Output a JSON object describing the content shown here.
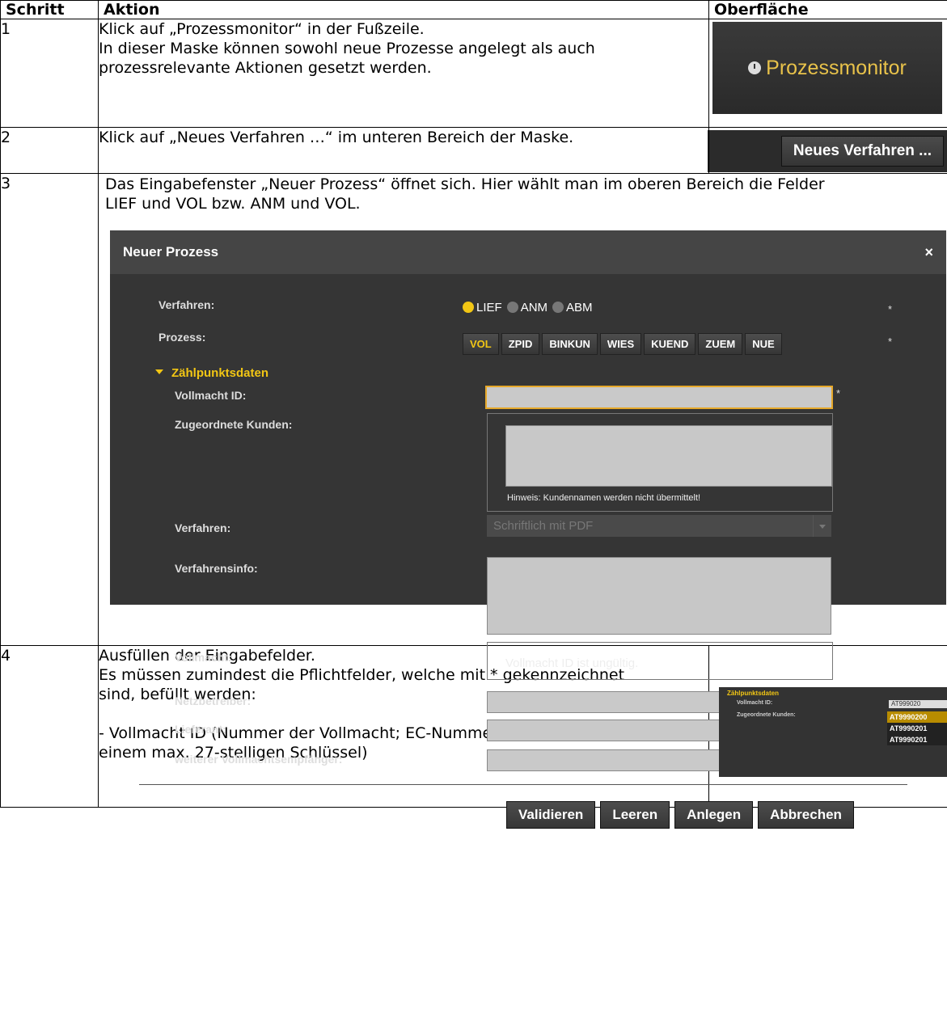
{
  "header": {
    "col1": "Schritt",
    "col2": "Aktion",
    "col3": "Oberfläche"
  },
  "rows": [
    {
      "nr": "1",
      "lines": [
        "Klick auf „Prozessmonitor“ in der Fußzeile.",
        "In dieser Maske können sowohl neue Prozesse angelegt als auch",
        "prozessrelevante Aktionen gesetzt werden."
      ],
      "ui_label": "Prozessmonitor"
    },
    {
      "nr": "2",
      "lines": [
        "Klick auf „Neues Verfahren …“ im unteren Bereich der Maske."
      ],
      "ui_label": "Neues Verfahren ..."
    },
    {
      "nr": "3",
      "lines": [
        "Das Eingabefenster „Neuer Prozess“ öffnet sich. Hier wählt man im oberen Bereich die Felder",
        "LIEF und VOL bzw. ANM und VOL."
      ]
    },
    {
      "nr": "4",
      "lines": [
        "Ausfüllen der Eingabefelder.",
        "Es müssen zumindest die Pflichtfelder, welche mit * gekennzeichnet",
        "sind, befüllt werden:",
        "",
        "- Vollmacht ID (Nummer der Vollmacht; EC-Nummer gefolgt von",
        "einem max. 27-stelligen Schlüssel)"
      ]
    }
  ],
  "dialog": {
    "title": "Neuer Prozess",
    "close": "×",
    "verfahren_label": "Verfahren:",
    "radios": [
      "LIEF",
      "ANM",
      "ABM"
    ],
    "radio_selected": "LIEF",
    "prozess_label": "Prozess:",
    "prozess_buttons": [
      "VOL",
      "ZPID",
      "BINKUN",
      "WIES",
      "KUEND",
      "ZUEM",
      "NUE"
    ],
    "prozess_selected": "VOL",
    "required_mark": "*",
    "section": "Zählpunktsdaten",
    "vollmacht_id_label": "Vollmacht ID:",
    "kunden_label": "Zugeordnete Kunden:",
    "kunden_hint": "Hinweis: Kundennamen werden nicht übermittelt!",
    "verfahren2_label": "Verfahren:",
    "verfahren2_value": "Schriftlich mit PDF",
    "verfahrensinfo_label": "Verfahrensinfo:",
    "vollmacht_label": "Vollmacht:",
    "vollmacht_status": "Vollmacht ID ist ungültig.",
    "netzbetreiber_label": "Netzbetreiber:",
    "lieferant_label": "Lieferant:",
    "empfaenger_label": "weiterer Vollmachtsempfänger:",
    "buttons": [
      "Validieren",
      "Leeren",
      "Anlegen",
      "Abbrechen"
    ],
    "colors": {
      "accent": "#f2c614",
      "background": "#353535",
      "header": "#454545"
    }
  },
  "mini": {
    "section": "Zählpunktsdaten",
    "vollmacht_id_label": "Vollmacht ID:",
    "kunden_label": "Zugeordnete Kunden:",
    "input_value": "AT999020",
    "suggestions": [
      "AT9990200",
      "AT9990201",
      "AT9990201"
    ]
  }
}
